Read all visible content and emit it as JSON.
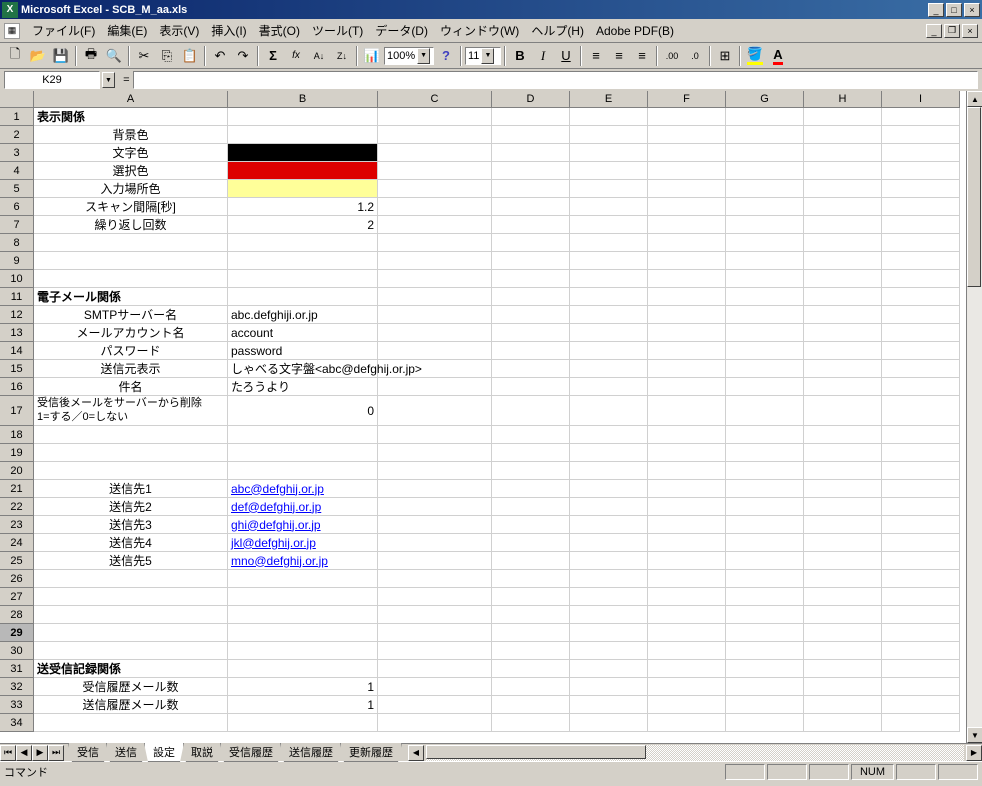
{
  "titlebar": {
    "app": "Microsoft Excel",
    "doc": "SCB_M_aa.xls"
  },
  "menu": {
    "file": "ファイル(F)",
    "edit": "編集(E)",
    "view": "表示(V)",
    "insert": "挿入(I)",
    "format": "書式(O)",
    "tools": "ツール(T)",
    "data": "データ(D)",
    "window": "ウィンドウ(W)",
    "help": "ヘルプ(H)",
    "adobe": "Adobe PDF(B)"
  },
  "toolbar": {
    "zoom": "100%",
    "fontsize": "11"
  },
  "namebox": "K29",
  "columns": [
    "A",
    "B",
    "C",
    "D",
    "E",
    "F",
    "G",
    "H",
    "I"
  ],
  "rows": [
    "1",
    "2",
    "3",
    "4",
    "5",
    "6",
    "7",
    "8",
    "9",
    "10",
    "11",
    "12",
    "13",
    "14",
    "15",
    "16",
    "17",
    "18",
    "19",
    "20",
    "21",
    "22",
    "23",
    "24",
    "25",
    "26",
    "27",
    "28",
    "29",
    "30",
    "31",
    "32",
    "33",
    "34"
  ],
  "active_row_index": 28,
  "cells": {
    "r1": {
      "A": "表示関係"
    },
    "r2": {
      "A": "背景色"
    },
    "r3": {
      "A": "文字色",
      "Bcolor": "#000000"
    },
    "r4": {
      "A": "選択色",
      "Bcolor": "#dd0000"
    },
    "r5": {
      "A": "入力場所色",
      "Bcolor": "#ffff99"
    },
    "r6": {
      "A": "スキャン間隔[秒]",
      "B": "1.2"
    },
    "r7": {
      "A": "繰り返し回数",
      "B": "2"
    },
    "r11": {
      "A": "電子メール関係"
    },
    "r12": {
      "A": "SMTPサーバー名",
      "B": "abc.defghiji.or.jp"
    },
    "r13": {
      "A": "メールアカウント名",
      "B": "account"
    },
    "r14": {
      "A": "パスワード",
      "B": "password"
    },
    "r15": {
      "A": "送信元表示",
      "B": "しゃべる文字盤<abc@defghij.or.jp>"
    },
    "r16": {
      "A": "件名",
      "B": "たろうより"
    },
    "r17": {
      "A": "受信後メールをサーバーから削除　1=する／0=しない",
      "B": "0"
    },
    "r21": {
      "A": "送信先1",
      "B": "abc@defghij.or.jp"
    },
    "r22": {
      "A": "送信先2",
      "B": "def@defghij.or.jp"
    },
    "r23": {
      "A": "送信先3",
      "B": "ghi@defghij.or.jp"
    },
    "r24": {
      "A": "送信先4",
      "B": "jkl@defghij.or.jp"
    },
    "r25": {
      "A": "送信先5",
      "B": "mno@defghij.or.jp"
    },
    "r31": {
      "A": "送受信記録関係"
    },
    "r32": {
      "A": "受信履歴メール数",
      "B": "1"
    },
    "r33": {
      "A": "送信履歴メール数",
      "B": "1"
    }
  },
  "tabs": {
    "items": [
      "受信",
      "送信",
      "設定",
      "取説",
      "受信履歴",
      "送信履歴",
      "更新履歴"
    ],
    "active_index": 2
  },
  "statusbar": {
    "mode": "コマンド",
    "num": "NUM"
  }
}
